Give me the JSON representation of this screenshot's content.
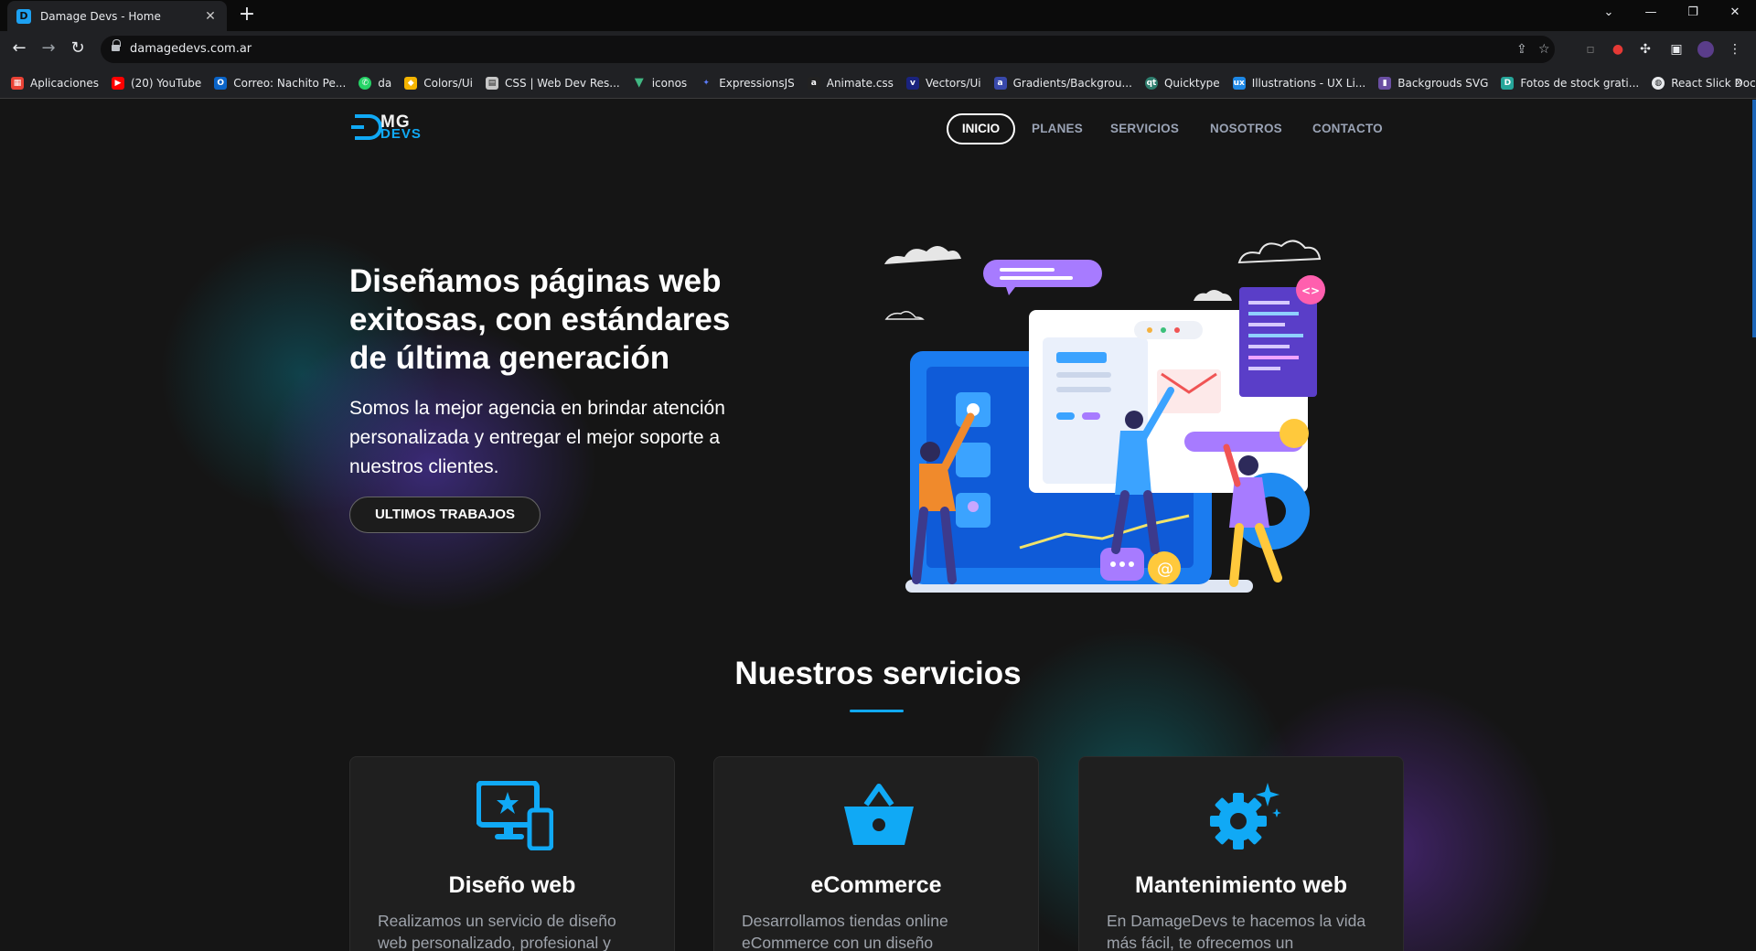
{
  "browser": {
    "tab_title": "Damage Devs - Home",
    "url": "damagedevs.com.ar",
    "bookmarks": [
      {
        "label": "Aplicaciones",
        "icon": "apps-grid-icon",
        "color": "#e94235"
      },
      {
        "label": "(20) YouTube",
        "icon": "youtube-icon",
        "color": "#ff0000"
      },
      {
        "label": "Correo: Nachito Pe...",
        "icon": "outlook-icon",
        "color": "#0a64c8"
      },
      {
        "label": "da",
        "icon": "whatsapp-icon",
        "color": "#25d366"
      },
      {
        "label": "Colors/Ui",
        "icon": "colors-icon",
        "color": "#f4b400"
      },
      {
        "label": "CSS | Web Dev Res...",
        "icon": "css-icon",
        "color": "#c7c7c7"
      },
      {
        "label": "iconos",
        "icon": "vue-icon",
        "color": "#41b883"
      },
      {
        "label": "ExpressionsJS",
        "icon": "expressions-icon",
        "color": "#5b7cfa"
      },
      {
        "label": "Animate.css",
        "icon": "animate-icon",
        "color": "#222222"
      },
      {
        "label": "Vectors/Ui",
        "icon": "vectors-icon",
        "color": "#1a237e"
      },
      {
        "label": "Gradients/Backgrou...",
        "icon": "gradients-icon",
        "color": "#3949ab"
      },
      {
        "label": "Quicktype",
        "icon": "quicktype-icon",
        "color": "#2e7d6d"
      },
      {
        "label": "Illustrations - UX Li...",
        "icon": "ux-icon",
        "color": "#1e88e5"
      },
      {
        "label": "Backgrouds SVG",
        "icon": "svg-icon",
        "color": "#6a4fa3"
      },
      {
        "label": "Fotos de stock grati...",
        "icon": "stock-photo-icon",
        "color": "#26a69a"
      },
      {
        "label": "React Slick Docume...",
        "icon": "globe-icon",
        "color": "#e8eaed"
      }
    ]
  },
  "site": {
    "logo_top": "MG",
    "logo_bottom": "DEVS",
    "nav": [
      "INICIO",
      "PLANES",
      "SERVICIOS",
      "NOSOTROS",
      "CONTACTO"
    ],
    "hero": {
      "title": "Diseñamos páginas web exitosas, con estándares de última generación",
      "subtitle": "Somos la mejor agencia en brindar atención personalizada y entregar el mejor soporte a nuestros clientes.",
      "button": "ULTIMOS TRABAJOS"
    },
    "services_title": "Nuestros servicios",
    "services": [
      {
        "title": "Diseño web",
        "desc": "Realizamos un servicio de diseño web personalizado, profesional y",
        "icon": "responsive-devices-icon"
      },
      {
        "title": "eCommerce",
        "desc": "Desarrollamos tiendas online eCommerce con un diseño",
        "icon": "shopping-basket-icon"
      },
      {
        "title": "Mantenimiento web",
        "desc": "En DamageDevs te hacemos la vida más fácil, te ofrecemos un",
        "icon": "gear-sparkle-icon"
      }
    ],
    "accent_color": "#10a9f5"
  }
}
